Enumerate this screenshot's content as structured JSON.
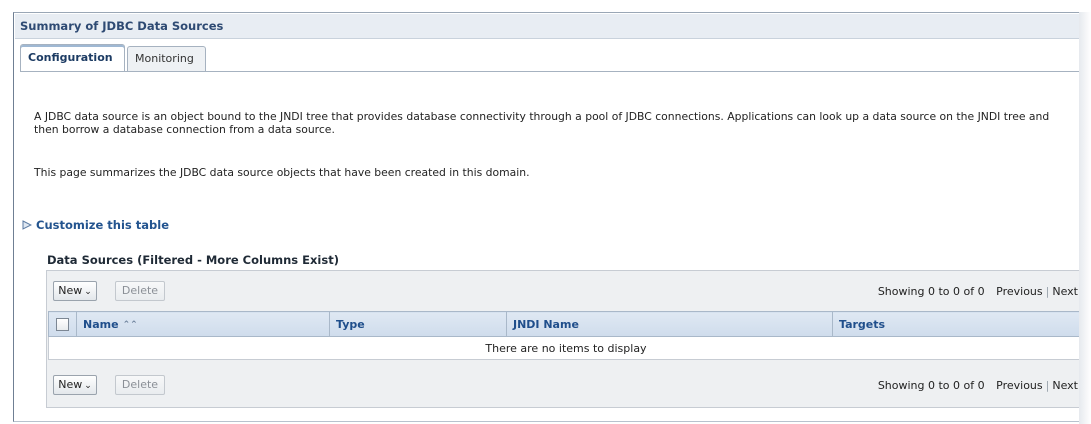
{
  "panel": {
    "title": "Summary of JDBC Data Sources"
  },
  "tabs": [
    {
      "label": "Configuration",
      "active": true
    },
    {
      "label": "Monitoring",
      "active": false
    }
  ],
  "description": {
    "paragraph1": "A JDBC data source is an object bound to the JNDI tree that provides database connectivity through a pool of JDBC connections. Applications can look up a data source on the JNDI tree and then borrow a database connection from a data source.",
    "paragraph2": "This page summarizes the JDBC data source objects that have been created in this domain."
  },
  "customize": {
    "label": "Customize this table",
    "icon": "expand-triangle-icon"
  },
  "table": {
    "title": "Data Sources (Filtered - More Columns Exist)",
    "columns": [
      "Name",
      "Type",
      "JNDI Name",
      "Targets"
    ],
    "sort_icon": "sort-ascending-icon",
    "empty_message": "There are no items to display",
    "toolbar": {
      "new_label": "New",
      "delete_label": "Delete",
      "showing": "Showing 0 to 0 of 0",
      "previous": "Previous",
      "next": "Next"
    }
  },
  "colors": {
    "link": "#23548f",
    "header_text": "#1f4e8b",
    "title_text": "#2e4a73"
  }
}
